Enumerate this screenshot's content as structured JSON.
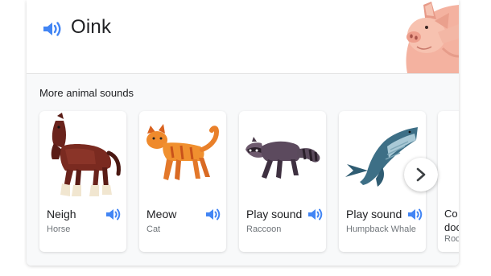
{
  "header": {
    "title": "Oink",
    "speaker_icon": "volume-icon",
    "image": "pig-illustration"
  },
  "section": {
    "title": "More animal sounds"
  },
  "cards": [
    {
      "label": "Neigh",
      "sub": "Horse",
      "image": "horse-illustration",
      "icon": "volume-icon"
    },
    {
      "label": "Meow",
      "sub": "Cat",
      "image": "cat-illustration",
      "icon": "volume-icon"
    },
    {
      "label": "Play sound",
      "sub": "Raccoon",
      "image": "raccoon-illustration",
      "icon": "volume-icon"
    },
    {
      "label": "Play sound",
      "sub": "Humpback Whale",
      "image": "whale-illustration",
      "icon": "volume-icon"
    },
    {
      "label": "Co",
      "label2": "doc",
      "sub": "Roc",
      "image": "partial-animal-illustration"
    }
  ],
  "navigation": {
    "next_icon": "chevron-right-icon"
  },
  "colors": {
    "accent_blue": "#4285f4",
    "text": "#202124",
    "subtext": "#70757a"
  }
}
